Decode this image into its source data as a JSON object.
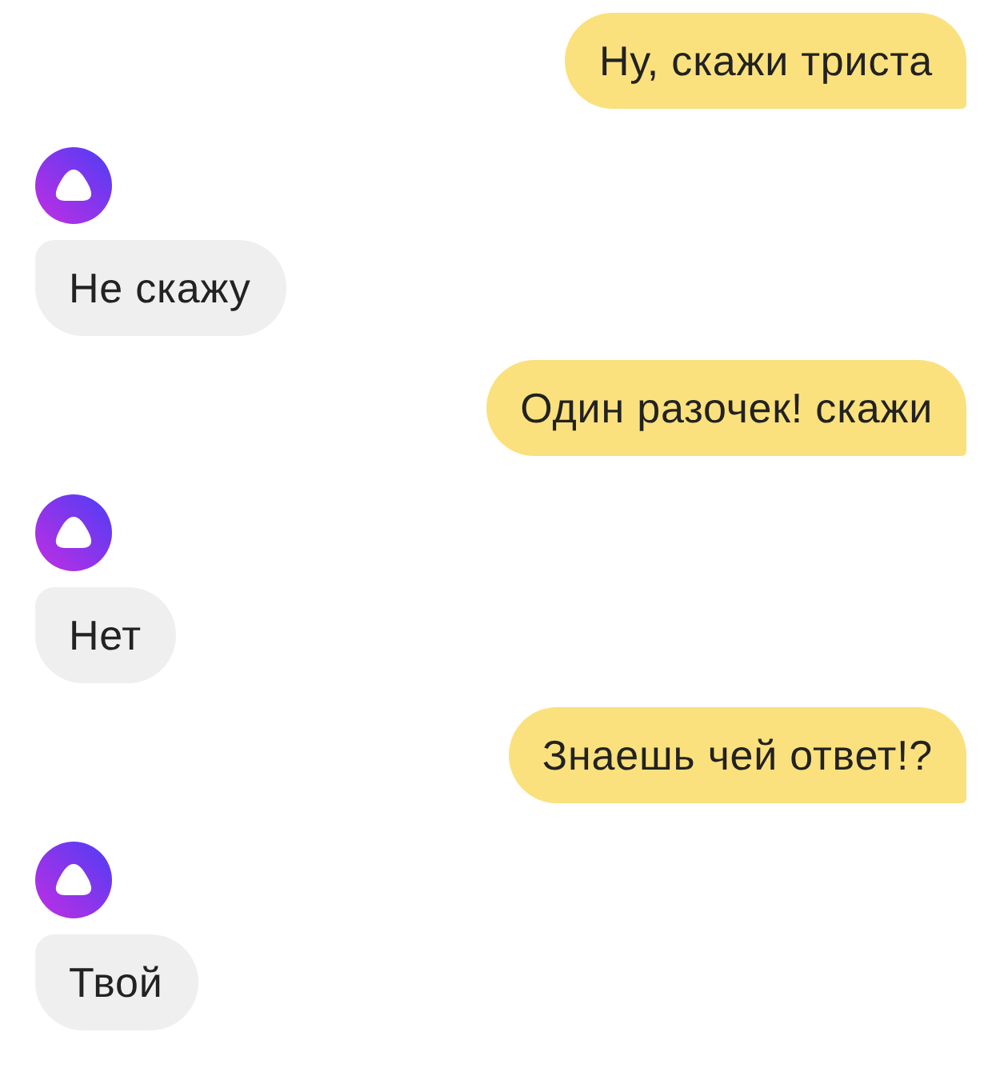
{
  "messages": [
    {
      "kind": "user",
      "text": "Ну, скажи триста"
    },
    {
      "kind": "assistant",
      "text": "Не скажу"
    },
    {
      "kind": "user",
      "text": "Один разочек! скажи"
    },
    {
      "kind": "assistant",
      "text": "Нет"
    },
    {
      "kind": "user",
      "text": "Знаешь чей ответ!?"
    },
    {
      "kind": "assistant",
      "text": "Твой"
    }
  ]
}
